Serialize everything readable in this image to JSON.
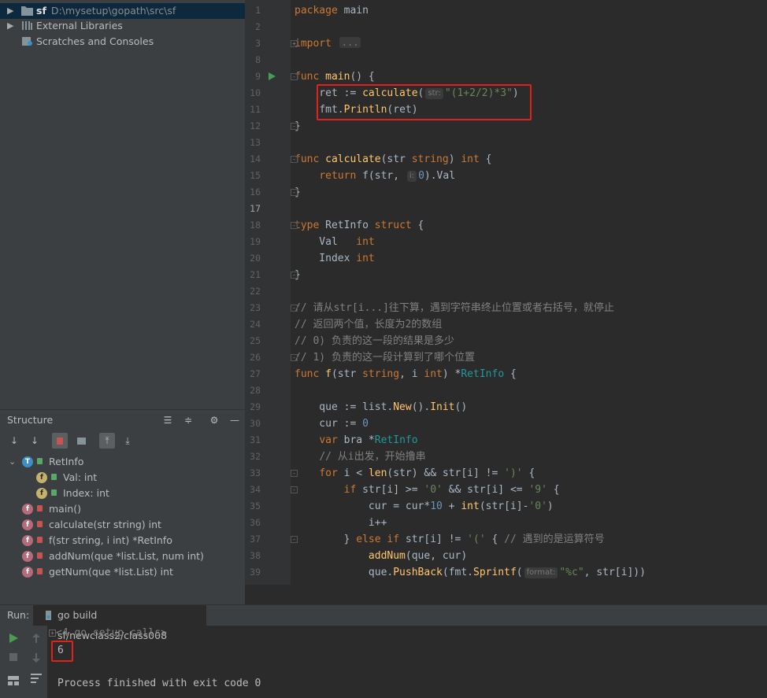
{
  "project": {
    "rows": [
      {
        "name": "sf",
        "path": "D:\\mysetup\\gopath\\src\\sf",
        "expanded": false
      },
      {
        "name": "External Libraries"
      },
      {
        "name": "Scratches and Consoles"
      }
    ]
  },
  "structure": {
    "title": "Structure",
    "items": [
      {
        "label": "RetInfo"
      },
      {
        "label": "Val: int"
      },
      {
        "label": "Index: int"
      },
      {
        "label": "main()"
      },
      {
        "label": "calculate(str string) int"
      },
      {
        "label": "f(str string, i int) *RetInfo"
      },
      {
        "label": "addNum(que *list.List, num int)"
      },
      {
        "label": "getNum(que *list.List) int"
      }
    ]
  },
  "editor": {
    "line_numbers": [
      "1",
      "2",
      "3",
      "8",
      "9",
      "10",
      "11",
      "12",
      "13",
      "14",
      "15",
      "16",
      "17",
      "18",
      "19",
      "20",
      "21",
      "22",
      "23",
      "24",
      "25",
      "26",
      "27",
      "28",
      "29",
      "30",
      "31",
      "32",
      "33",
      "34",
      "35",
      "36",
      "37",
      "38",
      "39"
    ],
    "hints": {
      "str": "str:",
      "i": "i:",
      "format": "format:"
    },
    "comments": {
      "c23": "// 请从str[i...]往下算，遇到字符串终止位置或者右括号，就停止",
      "c24": "// 返回两个值，长度为2的数组",
      "c25": "// 0) 负责的这一段的结果是多少",
      "c26": "// 1) 负责的这一段计算到了哪个位置",
      "c32": "// 从i出发，开始撸串",
      "c37": "// 遇到的是运算符号"
    }
  },
  "run": {
    "label": "Run:",
    "tab": "go build sf/newclass2/class008",
    "lines": [
      "<4 go setup calls>",
      "6",
      "",
      "Process finished with exit code 0"
    ]
  },
  "colors": {
    "highlight": "#e0221c",
    "keyword": "#cc7832",
    "function": "#ffc66d",
    "string": "#6a8759",
    "number": "#6897bb"
  }
}
